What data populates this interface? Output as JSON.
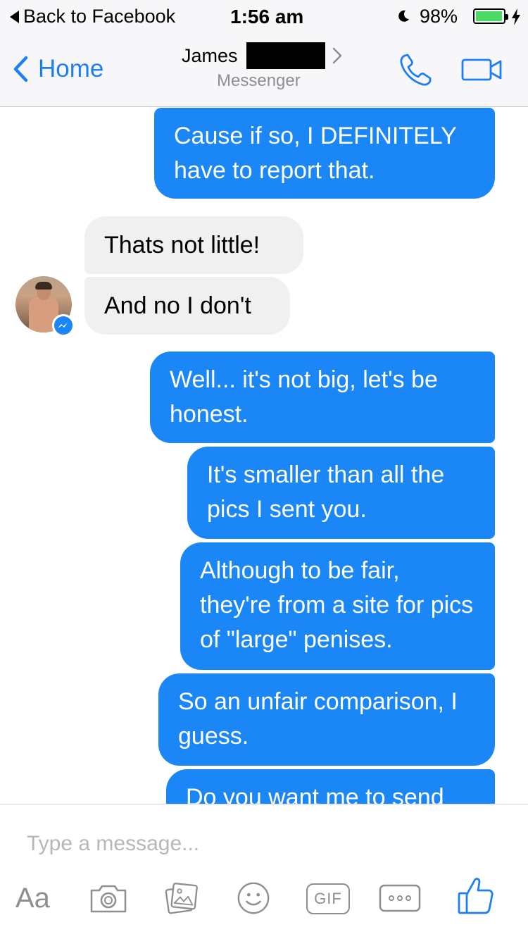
{
  "status_bar": {
    "back_app": "Back to Facebook",
    "time": "1:56 am",
    "battery": "98%",
    "battery_level": 0.98
  },
  "nav": {
    "back_label": "Home",
    "contact_name": "James",
    "contact_subtitle": "Messenger"
  },
  "messages": [
    {
      "sender": "me",
      "text": "Cause if so, I DEFINITELY have to report that."
    },
    {
      "sender": "them",
      "text": "Thats not little!"
    },
    {
      "sender": "them",
      "text": "And no I don't"
    },
    {
      "sender": "me",
      "text": "Well... it's not big, let's be honest."
    },
    {
      "sender": "me",
      "text": "It's smaller than all the pics I sent you."
    },
    {
      "sender": "me",
      "text": "Although to be fair, they're from a site for pics of \"large\" penises."
    },
    {
      "sender": "me",
      "text": "So an unfair comparison, I guess."
    },
    {
      "sender": "me",
      "text": "Do you want me to send"
    }
  ],
  "composer": {
    "placeholder": "Type a message...",
    "text_tool": "Aa",
    "gif_label": "GIF"
  },
  "colors": {
    "accent": "#1e7ff2",
    "outgoing_bubble": "#1b86f5",
    "incoming_bubble": "#f1f0f0",
    "icon_gray": "#8e8e93"
  }
}
